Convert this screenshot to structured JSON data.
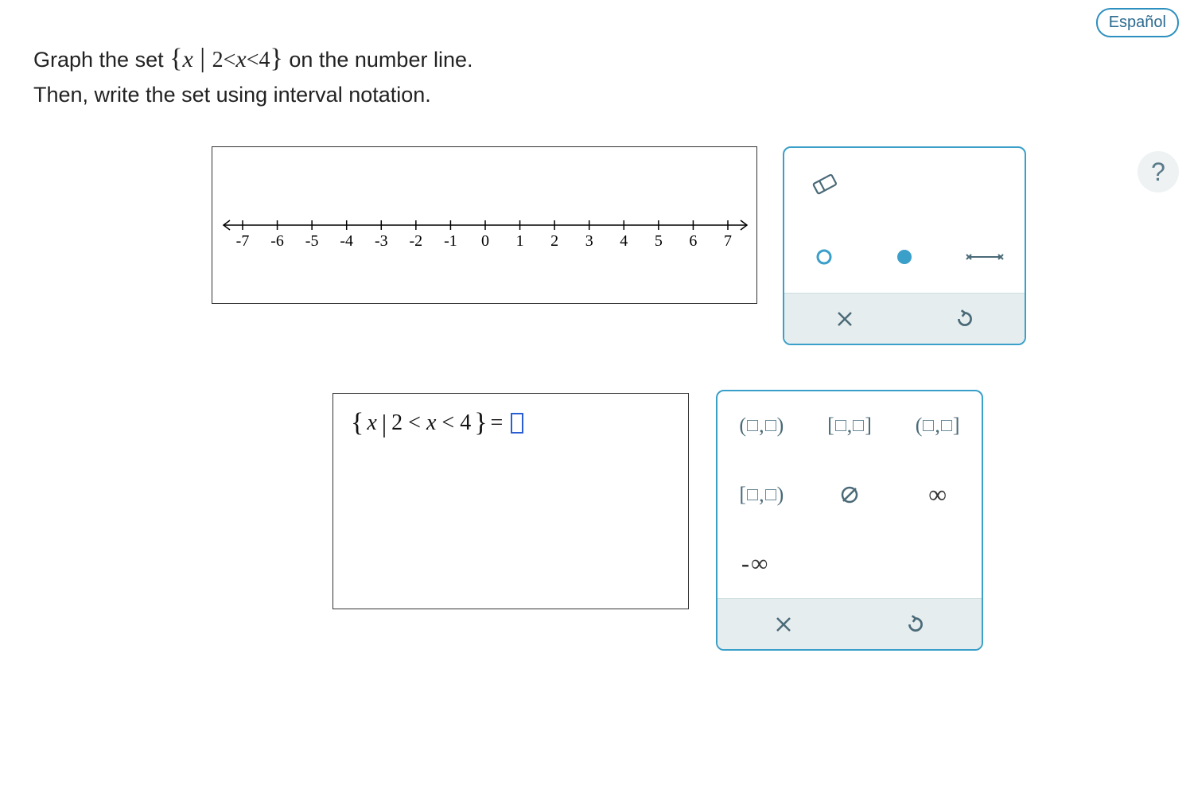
{
  "header": {
    "language_label": "Español",
    "help_label": "?"
  },
  "prompt": {
    "line1_pre": "Graph the set ",
    "set_open": "{",
    "var": "x",
    "bar": " | ",
    "condition": "2<x<4",
    "set_close": "}",
    "line1_post": " on the number line.",
    "line2": "Then, write the set using interval notation."
  },
  "number_line": {
    "ticks": [
      "-7",
      "-6",
      "-5",
      "-4",
      "-3",
      "-2",
      "-1",
      "0",
      "1",
      "2",
      "3",
      "4",
      "5",
      "6",
      "7"
    ]
  },
  "graph_tools": {
    "eraser": "eraser",
    "open_circle": "open-circle",
    "closed_circle": "closed-circle",
    "segment": "segment",
    "clear": "clear",
    "reset": "reset"
  },
  "answer": {
    "lhs_open": "{",
    "lhs_var": "x",
    "lhs_bar": "|",
    "lhs_cond": "2 < x < 4",
    "lhs_close": "}",
    "equals": " = "
  },
  "notation_tools": {
    "open_open": "(▢,▢)",
    "closed_closed": "[▢,▢]",
    "open_closed": "(▢,▢]",
    "closed_open": "[▢,▢)",
    "empty_set": "∅",
    "infinity": "∞",
    "neg_infinity": "-∞",
    "clear": "clear",
    "reset": "reset"
  }
}
